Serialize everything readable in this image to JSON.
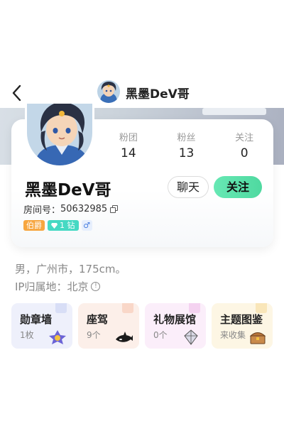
{
  "header": {
    "title": "黑墨DeV哥",
    "back_icon": "chevron-left-icon"
  },
  "profile": {
    "name": "黑墨DeV哥",
    "stats": [
      {
        "label": "粉团",
        "value": "14"
      },
      {
        "label": "粉丝",
        "value": "13"
      },
      {
        "label": "关注",
        "value": "0"
      }
    ],
    "chat_label": "聊天",
    "follow_label": "关注",
    "room_label": "房间号：",
    "room_number": "50632985",
    "badges": {
      "rank": "伯爵",
      "diamond": "1 钻",
      "gender": "♂"
    },
    "bio": "男，广州市，175cm。",
    "ip_label": "IP归属地：北京"
  },
  "tiles": [
    {
      "title": "勋章墙",
      "sub": "1枚",
      "bg": "#eef0fb"
    },
    {
      "title": "座驾",
      "sub": "9个",
      "bg": "#fcefe9"
    },
    {
      "title": "礼物展馆",
      "sub": "0个",
      "bg": "#fbeefa"
    },
    {
      "title": "主题图鉴",
      "sub": "来收集",
      "bg": "#fdf6e4"
    }
  ],
  "colors": {
    "follow": "#5ee0ab",
    "rank_badge": "#f7a640",
    "diamond_badge": "#46d9c3"
  }
}
